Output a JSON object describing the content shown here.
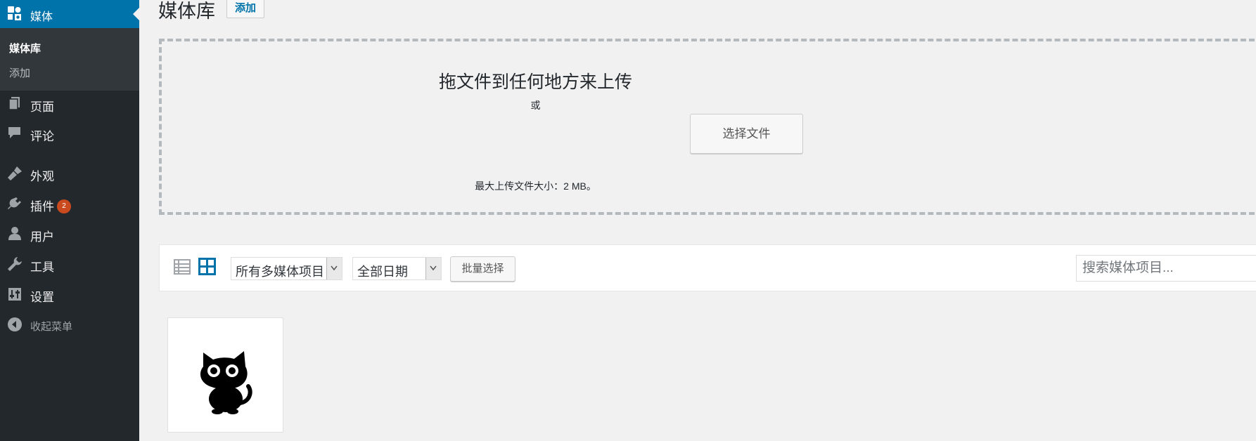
{
  "sidebar": {
    "current": {
      "label": "媒体",
      "icon": "media-icon"
    },
    "submenu": [
      {
        "label": "媒体库"
      },
      {
        "label": "添加"
      }
    ],
    "items": [
      {
        "label": "页面",
        "icon": "pages-icon"
      },
      {
        "label": "评论",
        "icon": "comments-icon"
      },
      {
        "label": "外观",
        "icon": "appearance-icon"
      },
      {
        "label": "插件",
        "icon": "plugins-icon",
        "badge": "2"
      },
      {
        "label": "用户",
        "icon": "users-icon"
      },
      {
        "label": "工具",
        "icon": "tools-icon"
      },
      {
        "label": "设置",
        "icon": "settings-icon"
      }
    ],
    "collapse": {
      "label": "收起菜单",
      "icon": "collapse-icon"
    }
  },
  "header": {
    "title": "媒体库",
    "add_label": "添加"
  },
  "uploader": {
    "drop_title": "拖文件到任何地方来上传",
    "or_text": "或",
    "select_label": "选择文件",
    "max_size": "最大上传文件大小：2 MB。"
  },
  "toolbar": {
    "list_view_icon": "list-view-icon",
    "grid_view_icon": "grid-view-icon",
    "type_filter": "所有多媒体项目",
    "date_filter": "全部日期",
    "bulk_label": "批量选择",
    "search_placeholder": "搜索媒体项目..."
  },
  "colors": {
    "accent": "#0073aa",
    "sidebar_bg": "#23282d",
    "badge": "#ca4a1f"
  }
}
